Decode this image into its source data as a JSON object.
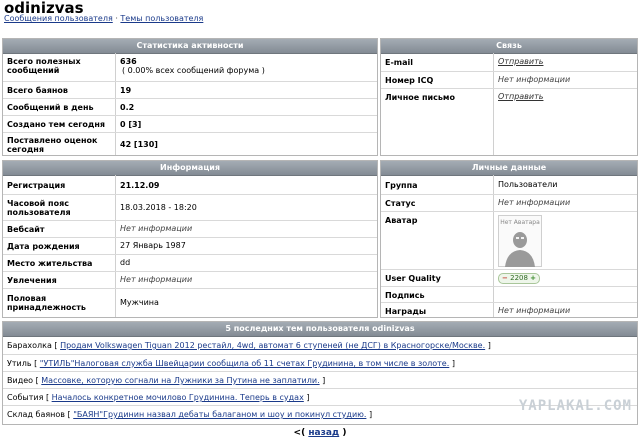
{
  "header": {
    "username": "odinizvas",
    "messages_link": "Сообщения пользователя",
    "separator": "·",
    "topics_link": "Темы пользователя"
  },
  "activity": {
    "title": "Статистика активности",
    "rows": [
      {
        "label": "Всего полезных сообщений",
        "value": "636",
        "note": "( 0.00% всех сообщений форума )"
      },
      {
        "label": "Всего баянов",
        "value": "19"
      },
      {
        "label": "Сообщений в день",
        "value": "0.2"
      },
      {
        "label": "Создано тем сегодня",
        "value": "0 [3]"
      },
      {
        "label": "Поставлено оценок сегодня",
        "value": "42 [130]"
      }
    ]
  },
  "contact": {
    "title": "Связь",
    "rows": [
      {
        "label": "E-mail",
        "value": "Отправить",
        "link": true
      },
      {
        "label": "Номер ICQ",
        "value": "Нет информации",
        "link": false
      },
      {
        "label": "Личное письмо",
        "value": "Отправить",
        "link": true
      }
    ]
  },
  "info": {
    "title": "Информация",
    "rows": [
      {
        "label": "Регистрация",
        "value": "21.12.09"
      },
      {
        "label": "Часовой пояс пользователя",
        "value": "18.03.2018 - 18:20"
      },
      {
        "label": "Вебсайт",
        "value": "Нет информации"
      },
      {
        "label": "Дата рождения",
        "value": "27 Январь 1987"
      },
      {
        "label": "Место жительства",
        "value": "dd"
      },
      {
        "label": "Увлечения",
        "value": "Нет информации"
      },
      {
        "label": "Половая принадлежность",
        "value": "Мужчина"
      }
    ]
  },
  "personal": {
    "title": "Личные данные",
    "group_label": "Группа",
    "group_value": "Пользователи",
    "status_label": "Статус",
    "status_value": "Нет информации",
    "avatar_label": "Аватар",
    "avatar_caption": "Нет Аватара",
    "quality_label": "User Quality",
    "quality_minus": "−",
    "quality_value": "2208",
    "quality_plus": "+",
    "signature_label": "Подпись",
    "awards_label": "Награды",
    "awards_value": "Нет информации"
  },
  "topics": {
    "title": "5 последних тем пользователя odinizvas",
    "items": [
      {
        "section": "Барахолка",
        "topic": "Продам Volkswagen Tiguan 2012 рестайл, 4wd, автомат 6 ступеней (не ДСГ) в Красногорске/Москве."
      },
      {
        "section": "Утиль",
        "topic": "\"УТИЛЬ\"Налоговая служба Швейцарии сообщила об 11 счетах Грудинина, в том числе в золоте."
      },
      {
        "section": "Видео",
        "topic": "Массовке, которую согнали на Лужники за Путина не заплатили."
      },
      {
        "section": "События",
        "topic": "Началось конкретное мочилово Грудинина. Теперь в судах"
      },
      {
        "section": "Склад баянов",
        "topic": "\"БАЯН\"Грудинин назвал дебаты балаганом и шоу и покинул студию."
      }
    ]
  },
  "watermark": "YAPLAKAL.COM",
  "footer": {
    "back_prefix": "<(",
    "back_label": "назад",
    "back_suffix": ")"
  }
}
